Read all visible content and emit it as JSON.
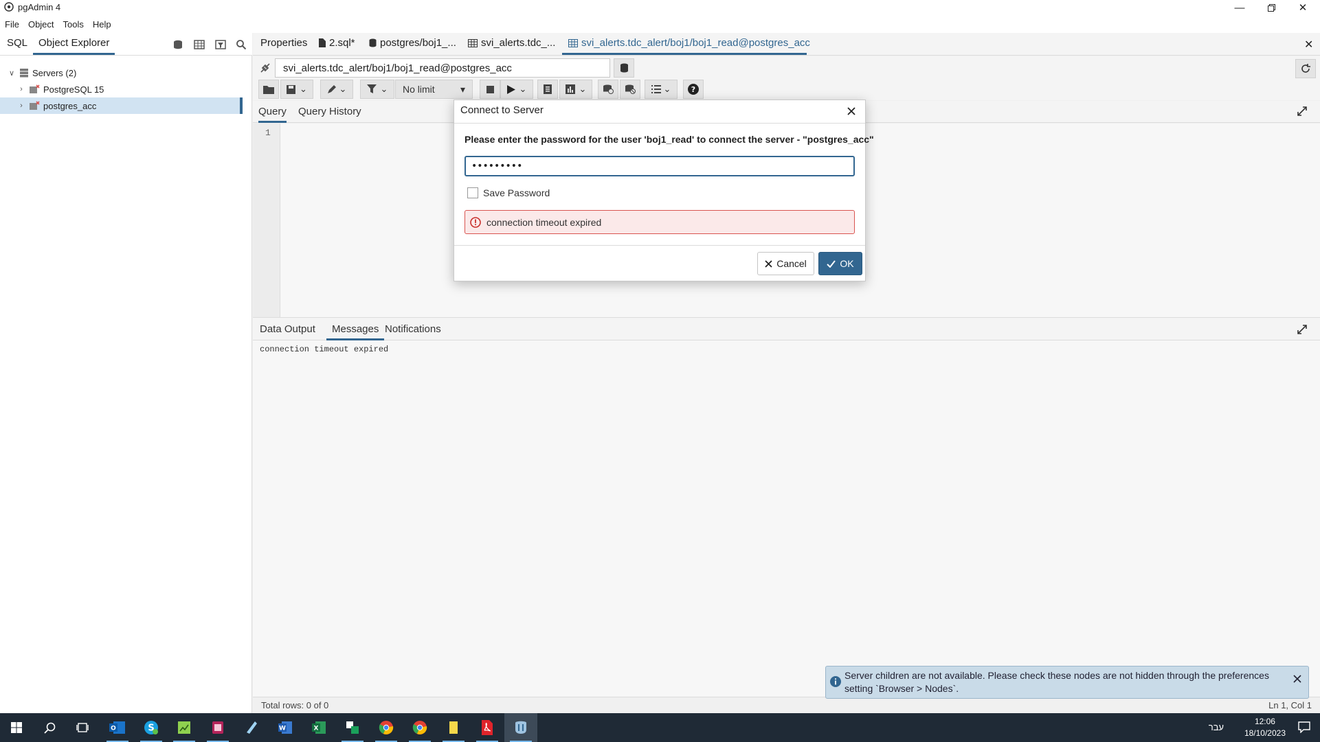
{
  "window": {
    "title": "pgAdmin 4"
  },
  "menu": [
    "File",
    "Object",
    "Tools",
    "Help"
  ],
  "left_panel": {
    "tabs": [
      {
        "label": "SQL",
        "active": false
      },
      {
        "label": "Object Explorer",
        "active": true
      }
    ],
    "tree": [
      {
        "label": "Servers (2)",
        "expanded": true
      },
      {
        "label": "PostgreSQL 15",
        "expanded": false
      },
      {
        "label": "postgres_acc",
        "expanded": false,
        "selected": true
      }
    ]
  },
  "main_tabs": [
    {
      "label": "Properties",
      "icon": "none"
    },
    {
      "label": "2.sql*",
      "icon": "file-icon"
    },
    {
      "label": "postgres/boj1_...",
      "icon": "query-tool-icon"
    },
    {
      "label": "svi_alerts.tdc_...",
      "icon": "table-icon"
    },
    {
      "label": "svi_alerts.tdc_alert/boj1/boj1_read@postgres_acc",
      "icon": "table-icon",
      "active": true
    }
  ],
  "connection": {
    "value": "svi_alerts.tdc_alert/boj1/boj1_read@postgres_acc"
  },
  "toolbar": {
    "limit_label": "No limit"
  },
  "editor": {
    "tabs": [
      {
        "label": "Query",
        "active": true
      },
      {
        "label": "Query History",
        "active": false
      }
    ],
    "line_number": "1"
  },
  "output": {
    "tabs": [
      {
        "label": "Data Output",
        "active": false
      },
      {
        "label": "Messages",
        "active": true
      },
      {
        "label": "Notifications",
        "active": false
      }
    ],
    "message": "connection timeout expired"
  },
  "status": {
    "rows": "Total rows: 0 of 0",
    "cursor": "Ln 1, Col 1"
  },
  "dialog": {
    "title": "Connect to Server",
    "prompt": "Please enter the password for the user 'boj1_read' to connect the server - \"postgres_acc\"",
    "password_value": "•••••••••",
    "save_password_label": "Save Password",
    "save_password_checked": false,
    "error": "connection timeout expired",
    "cancel_label": "Cancel",
    "ok_label": "OK"
  },
  "toast": {
    "text": "Server children are not available. Please check these nodes are not hidden through the preferences setting `Browser > Nodes`."
  },
  "taskbar": {
    "apps": [
      "start-icon",
      "search-icon",
      "task-view-icon",
      "outlook-icon",
      "skype-icon",
      "notepad-icon",
      "app-icon",
      "pen-icon",
      "word-icon",
      "excel-icon",
      "share-icon",
      "chrome-icon",
      "chrome-icon",
      "notes-icon",
      "pdf-icon",
      "pgadmin-icon"
    ],
    "language": "עבר",
    "time": "12:06",
    "date": "18/10/2023"
  },
  "colors": {
    "accent": "#326690",
    "error_bg": "#fbe9e9",
    "error_border": "#d9534f",
    "toast_bg": "#c9dbe8",
    "taskbar": "#1f2a36"
  }
}
